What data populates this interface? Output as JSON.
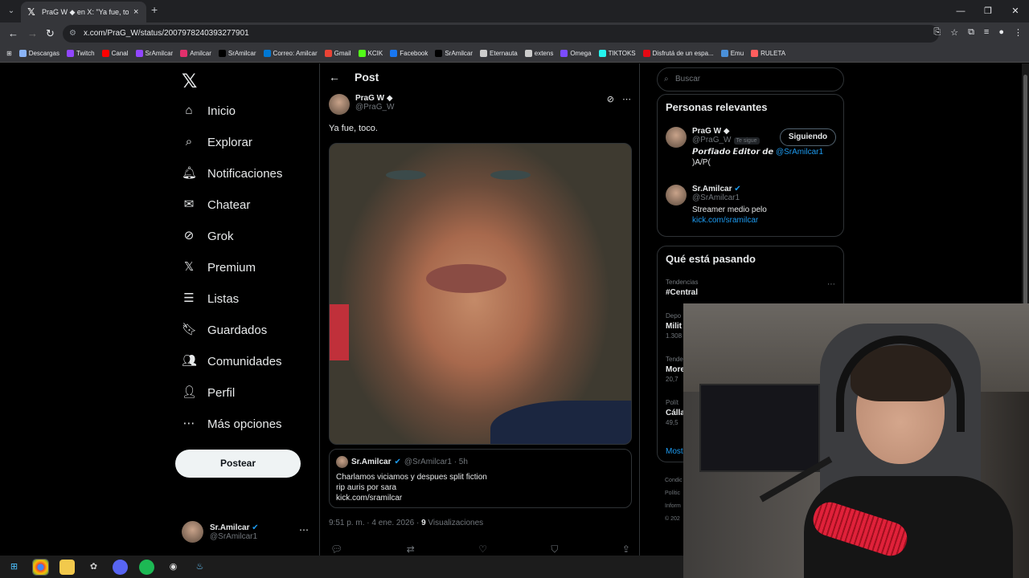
{
  "browser": {
    "tab_title": "PraG W ◆ en X: \"Ya fue, toco.\"",
    "url": "x.com/PraG_W/status/2007978240393277901",
    "bookmarks": [
      {
        "label": "Descargas",
        "color": "#8ab4f8"
      },
      {
        "label": "Twitch",
        "color": "#9146ff"
      },
      {
        "label": "Canal",
        "color": "#ff0000"
      },
      {
        "label": "SrAmilcar",
        "color": "#9146ff"
      },
      {
        "label": "Amilcar",
        "color": "#e1306c"
      },
      {
        "label": "SrAmilcar",
        "color": "#000000"
      },
      {
        "label": "Correo: Amilcar",
        "color": "#0078d4"
      },
      {
        "label": "Gmail",
        "color": "#ea4335"
      },
      {
        "label": "KCIK",
        "color": "#53fc18"
      },
      {
        "label": "Facebook",
        "color": "#1877f2"
      },
      {
        "label": "SrAmilcar",
        "color": "#000000"
      },
      {
        "label": "Eternauta",
        "color": "#cccccc"
      },
      {
        "label": "extens",
        "color": "#cccccc"
      },
      {
        "label": "Omega",
        "color": "#7b4bff"
      },
      {
        "label": "TIKTOKS",
        "color": "#25f4ee"
      },
      {
        "label": "Disfrutá de un espa...",
        "color": "#e50914"
      },
      {
        "label": "Emu",
        "color": "#4a90d9"
      },
      {
        "label": "RULETA",
        "color": "#ff5e5e"
      }
    ]
  },
  "nav": {
    "items": [
      {
        "label": "Inicio",
        "icon": "home-icon",
        "glyph": "⌂"
      },
      {
        "label": "Explorar",
        "icon": "search-icon",
        "glyph": "⌕"
      },
      {
        "label": "Notificaciones",
        "icon": "bell-icon",
        "glyph": "🔔︎"
      },
      {
        "label": "Chatear",
        "icon": "mail-icon",
        "glyph": "✉"
      },
      {
        "label": "Grok",
        "icon": "grok-icon",
        "glyph": "⊘"
      },
      {
        "label": "Premium",
        "icon": "x-premium-icon",
        "glyph": "𝕏"
      },
      {
        "label": "Listas",
        "icon": "list-icon",
        "glyph": "☰"
      },
      {
        "label": "Guardados",
        "icon": "bookmark-icon",
        "glyph": "🔖︎"
      },
      {
        "label": "Comunidades",
        "icon": "communities-icon",
        "glyph": "👥︎"
      },
      {
        "label": "Perfil",
        "icon": "profile-icon",
        "glyph": "👤︎"
      },
      {
        "label": "Más opciones",
        "icon": "more-icon",
        "glyph": "⋯"
      }
    ],
    "post_button": "Postear",
    "account": {
      "name": "Sr.Amilcar",
      "handle": "@SrAmilcar1"
    }
  },
  "post": {
    "header": "Post",
    "author_name": "PraG W ◆",
    "author_handle": "@PraG_W",
    "text": "Ya fue, toco.",
    "quote": {
      "name": "Sr.Amilcar",
      "handle_time": "@SrAmilcar1 · 5h",
      "line1": "Charlamos viciamos y despues split fiction",
      "line2": "rip auris por sara",
      "line3": "kick.com/sramilcar"
    },
    "timestamp": "9:51 p. m. · 4 ene. 2026 · ",
    "views_count": "9",
    "views_label": " Visualizaciones"
  },
  "sidebar": {
    "search_placeholder": "Buscar",
    "relevant_title": "Personas relevantes",
    "people": [
      {
        "name": "PraG W ◆",
        "handle": "@PraG_W",
        "tag": "Te sigue",
        "bio": "𝙋𝙤𝙧𝙛𝙞𝙖𝙙𝙤 𝙀𝙙𝙞𝙩𝙤𝙧 𝙙𝙚 ",
        "bio_link": "@SrAmilcar1",
        "bio2": ")A/P(",
        "button": "Siguiendo"
      },
      {
        "name": "Sr.Amilcar",
        "handle": "@SrAmilcar1",
        "bio": "Streamer medio pelo",
        "bio_link": "kick.com/sramilcar"
      }
    ],
    "trending_title": "Qué está pasando",
    "trends": [
      {
        "category": "Tendencias",
        "name": "#Central",
        "count": ""
      },
      {
        "category": "Depo",
        "name": "Milit",
        "count": "1.308"
      },
      {
        "category": "Tende",
        "name": "More",
        "count": "20,7"
      },
      {
        "category": "Polít",
        "name": "Cálla",
        "count": "49,5"
      }
    ],
    "show_more": "Most",
    "footer": [
      "Condic",
      "Polític",
      "Inform",
      "© 202"
    ]
  }
}
